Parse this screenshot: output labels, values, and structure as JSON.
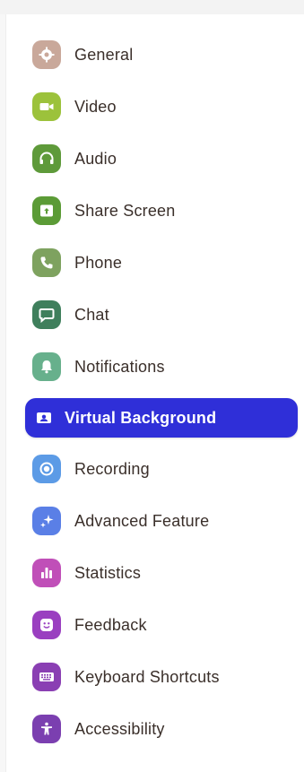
{
  "sidebar": {
    "items": [
      {
        "label": "General",
        "icon": "gear-icon",
        "color": "#c9a89a"
      },
      {
        "label": "Video",
        "icon": "video-camera-icon",
        "color": "#9cc23b"
      },
      {
        "label": "Audio",
        "icon": "headphones-icon",
        "color": "#5e9a3a"
      },
      {
        "label": "Share Screen",
        "icon": "share-screen-icon",
        "color": "#5b9b36"
      },
      {
        "label": "Phone",
        "icon": "phone-icon",
        "color": "#7ea25f"
      },
      {
        "label": "Chat",
        "icon": "chat-bubble-icon",
        "color": "#3f7f5c"
      },
      {
        "label": "Notifications",
        "icon": "bell-icon",
        "color": "#67b08c"
      },
      {
        "label": "Virtual Background",
        "icon": "person-card-icon",
        "color": "#2f2fd8",
        "active": true
      },
      {
        "label": "Recording",
        "icon": "record-icon",
        "color": "#5c9be6"
      },
      {
        "label": "Advanced Feature",
        "icon": "sparkle-icon",
        "color": "#5a7fe6"
      },
      {
        "label": "Statistics",
        "icon": "bar-chart-icon",
        "color": "#c04fb8"
      },
      {
        "label": "Feedback",
        "icon": "smiley-icon",
        "color": "#9a3fc0"
      },
      {
        "label": "Keyboard Shortcuts",
        "icon": "keyboard-icon",
        "color": "#8a3fb3"
      },
      {
        "label": "Accessibility",
        "icon": "accessibility-icon",
        "color": "#7b3fb0"
      }
    ]
  }
}
